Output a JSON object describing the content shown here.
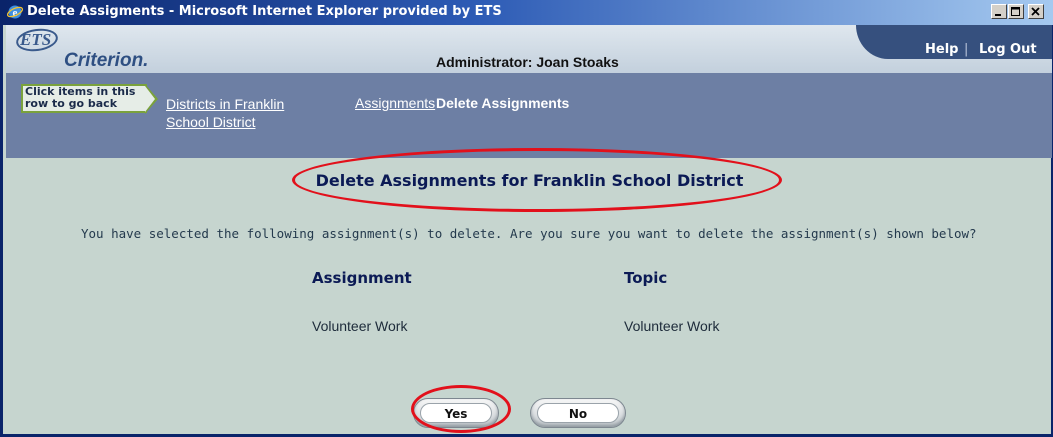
{
  "window": {
    "title": "Delete Assigments - Microsoft Internet Explorer provided by ETS"
  },
  "header": {
    "logo_ets": "ETS",
    "logo_criterion": "Criterion.",
    "admin": "Administrator: Joan Stoaks",
    "help": "Help",
    "separator": "|",
    "logout": "Log Out"
  },
  "breadcrumb": {
    "hint": "Click items in this row to go back",
    "items": [
      "Districts in Franklin School District",
      "Assignments"
    ],
    "current": "Delete Assignments"
  },
  "main": {
    "heading": "Delete Assignments for Franklin School District",
    "prompt": "You have selected the following assignment(s) to delete. Are you sure you want to delete the assignment(s) shown below?",
    "columns": [
      "Assignment",
      "Topic"
    ],
    "rows": [
      [
        "Volunteer Work",
        "Volunteer Work"
      ]
    ],
    "yes_label": "Yes",
    "no_label": "No"
  },
  "colors": {
    "highlight": "#e2101b",
    "titlebar": "#0a246a",
    "breadcrumb_bg": "#6d7fa4",
    "content_bg": "#c6d5cf"
  },
  "icons": [
    "ie-icon",
    "minimize-icon",
    "maximize-icon",
    "close-icon"
  ]
}
